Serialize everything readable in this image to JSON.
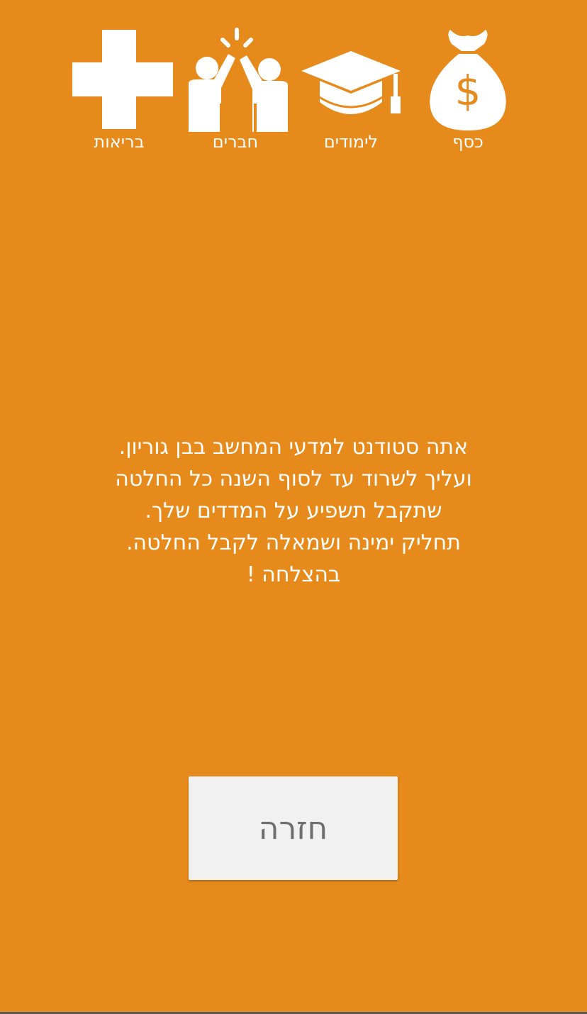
{
  "stats": {
    "money": {
      "label": "כסף",
      "icon": "money-bag-icon",
      "symbol": "$"
    },
    "studies": {
      "label": "לימודים",
      "icon": "graduation-cap-icon"
    },
    "friends": {
      "label": "חברים",
      "icon": "high-five-icon"
    },
    "health": {
      "label": "בריאות",
      "icon": "medical-cross-icon"
    }
  },
  "intro": {
    "lines": [
      "אתה סטודנט למדעי המחשב בבן גוריון.",
      "ועליך לשרוד עד לסוף השנה כל החלטה",
      "שתקבל תשפיע על המדדים שלך.",
      "תחליק ימינה ושמאלה לקבל החלטה.",
      "בהצלחה !"
    ]
  },
  "back_button": {
    "label": "חזרה"
  },
  "colors": {
    "background": "#E68A1C",
    "icon": "#FFFFFF",
    "button_bg": "#F1F1F1",
    "button_text": "#6E6E6E"
  }
}
